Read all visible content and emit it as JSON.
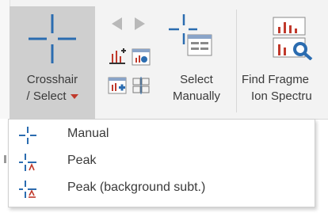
{
  "ribbon": {
    "crosshair_select": {
      "line1": "Crosshair",
      "line2": "/ Select",
      "icon": "crosshair-icon"
    },
    "select_manually": {
      "line1": "Select",
      "line2": "Manually",
      "icon": "select-manually-icon"
    },
    "find_fragment": {
      "line1": "Find Fragme",
      "line2": "Ion Spectru",
      "icon": "find-fragment-spectrum-icon"
    },
    "small_icons": [
      "arrow-left-icon",
      "arrow-right-icon",
      "peak-label-icon",
      "spectrum-search-icon",
      "add-spectrum-icon",
      "grid-compare-icon"
    ]
  },
  "dropdown": {
    "items": [
      {
        "label": "Manual",
        "icon": "crosshair-manual-icon"
      },
      {
        "label": "Peak",
        "icon": "crosshair-peak-icon"
      },
      {
        "label": "Peak (background subt.)",
        "icon": "crosshair-peak-background-icon"
      }
    ]
  },
  "colors": {
    "accent_blue": "#2b6cb0",
    "caret_red": "#c0392b",
    "pressed_bg": "#cfcfcf"
  }
}
